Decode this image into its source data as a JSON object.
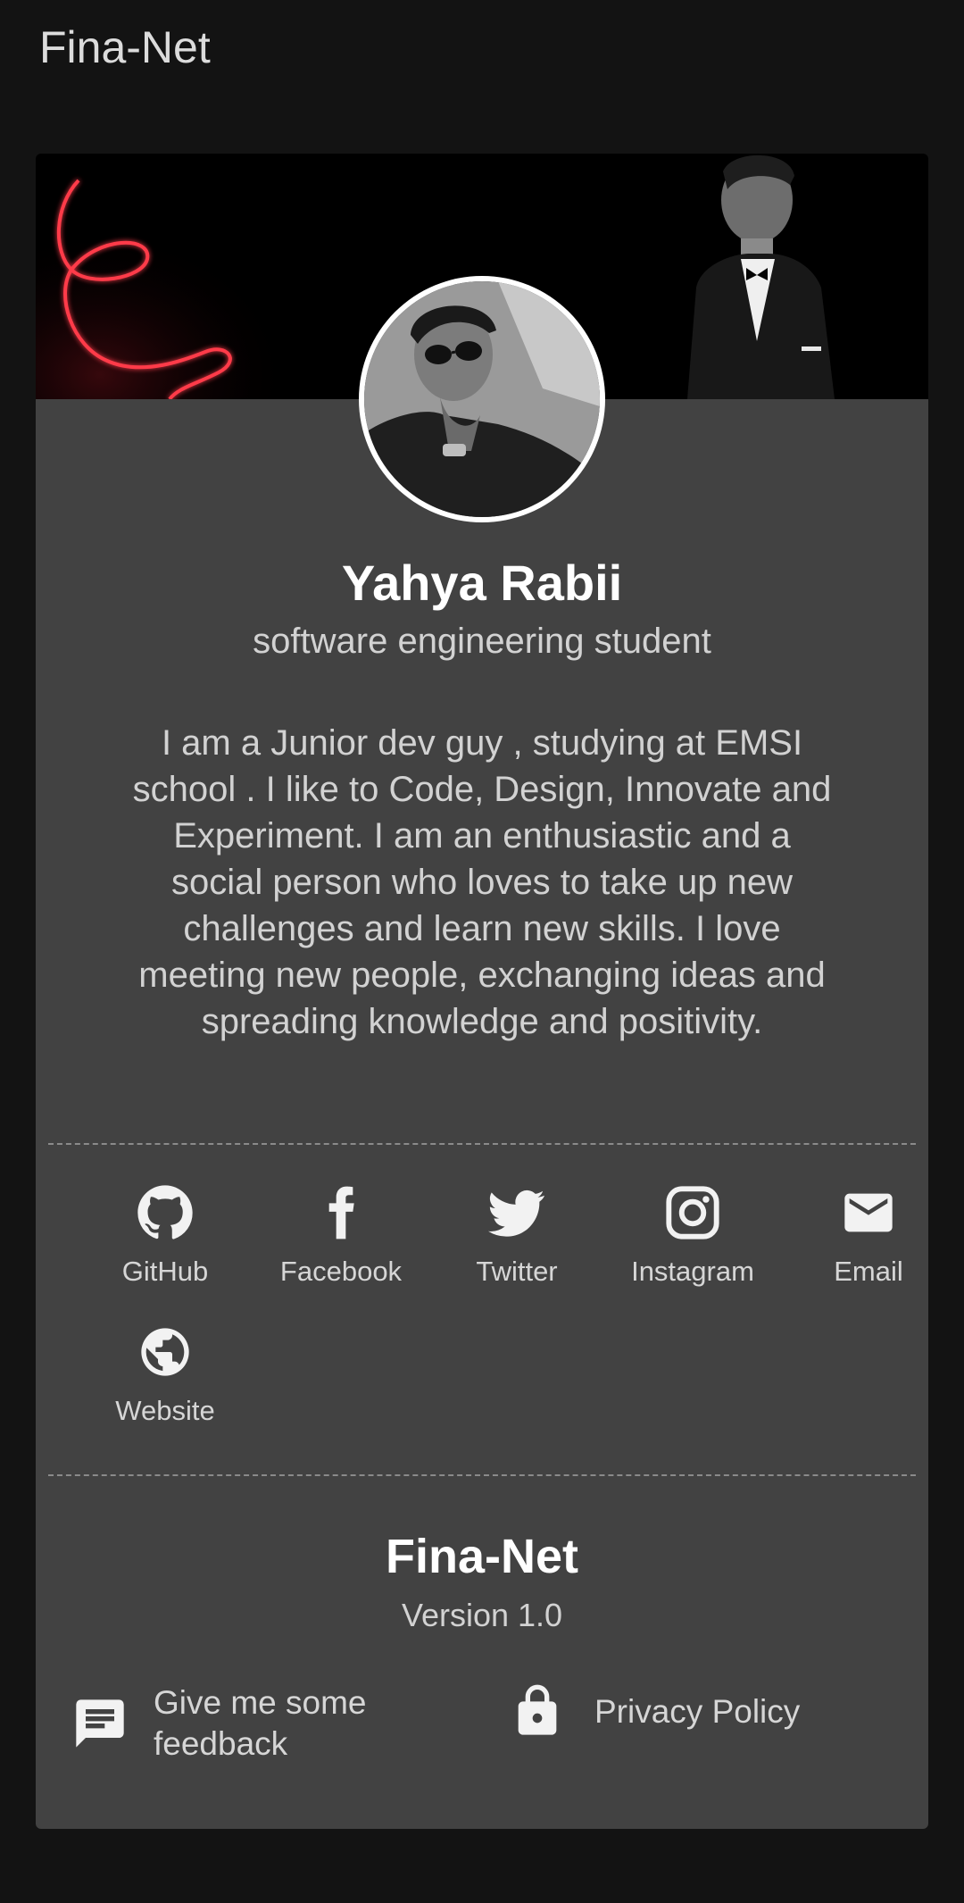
{
  "app_bar": {
    "title": "Fina-Net"
  },
  "profile": {
    "name": "Yahya Rabii",
    "subtitle": "software engineering student",
    "bio": "I am a Junior dev guy , studying at EMSI school . I like to Code, Design, Innovate and Experiment. I am an enthusiastic and a social person who loves to take up new challenges and learn new skills. I love meeting new people, exchanging ideas and spreading knowledge and positivity."
  },
  "socials": [
    {
      "label": "GitHub",
      "icon": "github-icon"
    },
    {
      "label": "Facebook",
      "icon": "facebook-icon"
    },
    {
      "label": "Twitter",
      "icon": "twitter-icon"
    },
    {
      "label": "Instagram",
      "icon": "instagram-icon"
    },
    {
      "label": "Email",
      "icon": "email-icon"
    },
    {
      "label": "Website",
      "icon": "globe-icon"
    }
  ],
  "footer": {
    "app_name": "Fina-Net",
    "version": "Version 1.0",
    "feedback_label": "Give me some feedback",
    "privacy_label": "Privacy Policy"
  },
  "colors": {
    "background": "#131313",
    "card": "#424242",
    "text_primary": "#ffffff",
    "text_secondary": "#d2d2d2",
    "neon_accent": "#ff3b4a"
  }
}
